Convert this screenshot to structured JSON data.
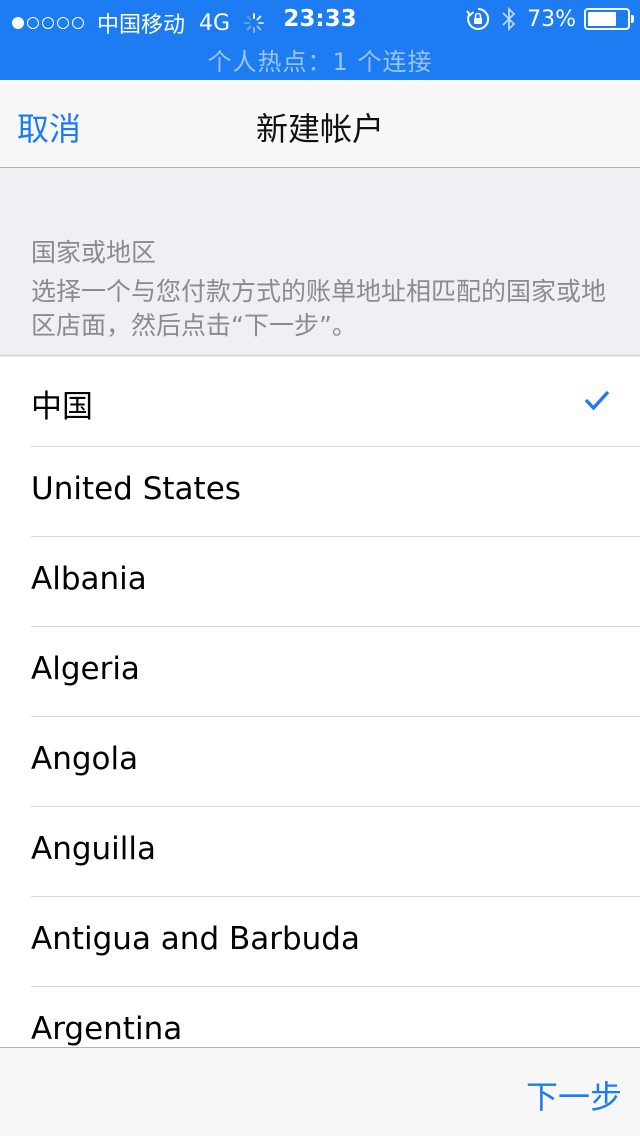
{
  "status_bar": {
    "signal_dots": [
      true,
      false,
      false,
      false,
      false
    ],
    "carrier": "中国移动",
    "network": "4G",
    "time": "23:33",
    "battery_percent": "73%",
    "battery_level": 0.73,
    "hotspot_text": "个人热点：1 个连接",
    "icons": [
      "signal-dots-icon",
      "activity-spinner-icon",
      "rotation-lock-icon",
      "bluetooth-icon",
      "battery-icon"
    ]
  },
  "nav": {
    "cancel_label": "取消",
    "title": "新建帐户"
  },
  "section": {
    "title": "国家或地区",
    "description": "选择一个与您付款方式的账单地址相匹配的国家或地区店面，然后点击“下一步”。"
  },
  "countries": [
    {
      "label": "中国",
      "selected": true
    },
    {
      "label": "United States",
      "selected": false
    },
    {
      "label": "Albania",
      "selected": false
    },
    {
      "label": "Algeria",
      "selected": false
    },
    {
      "label": "Angola",
      "selected": false
    },
    {
      "label": "Anguilla",
      "selected": false
    },
    {
      "label": "Antigua and Barbuda",
      "selected": false
    },
    {
      "label": "Argentina",
      "selected": false
    }
  ],
  "toolbar": {
    "next_label": "下一步"
  },
  "colors": {
    "accent": "#1d7cf1",
    "status_bar_bg": "#1d7cf1",
    "group_bg": "#efeff4",
    "secondary_text": "#8a8a8f"
  }
}
